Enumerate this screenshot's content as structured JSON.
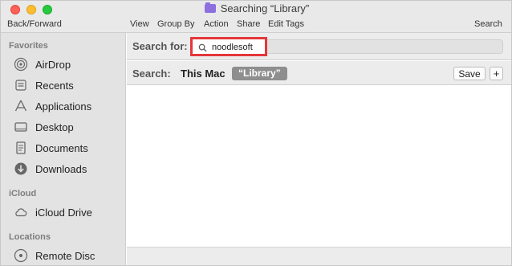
{
  "window": {
    "title": "Searching “Library”",
    "title_icon": "smart-folder-icon"
  },
  "toolbar": {
    "back_forward": "Back/Forward",
    "view": "View",
    "group_by": "Group By",
    "action": "Action",
    "share": "Share",
    "edit_tags": "Edit Tags",
    "search": "Search"
  },
  "sidebar": {
    "favorites_label": "Favorites",
    "favorites": [
      {
        "label": "AirDrop",
        "icon": "airdrop-icon"
      },
      {
        "label": "Recents",
        "icon": "recents-icon"
      },
      {
        "label": "Applications",
        "icon": "applications-icon"
      },
      {
        "label": "Desktop",
        "icon": "desktop-icon"
      },
      {
        "label": "Documents",
        "icon": "documents-icon"
      },
      {
        "label": "Downloads",
        "icon": "downloads-icon"
      }
    ],
    "icloud_label": "iCloud",
    "icloud": [
      {
        "label": "iCloud Drive",
        "icon": "cloud-icon"
      }
    ],
    "locations_label": "Locations",
    "locations": [
      {
        "label": "Remote Disc",
        "icon": "disc-icon"
      }
    ]
  },
  "search": {
    "label": "Search for:",
    "query": "noodlesoft",
    "highlight_color": "#e4373a"
  },
  "scope": {
    "label": "Search:",
    "this_mac": "This Mac",
    "library": "“Library”",
    "save": "Save",
    "add": "+"
  }
}
